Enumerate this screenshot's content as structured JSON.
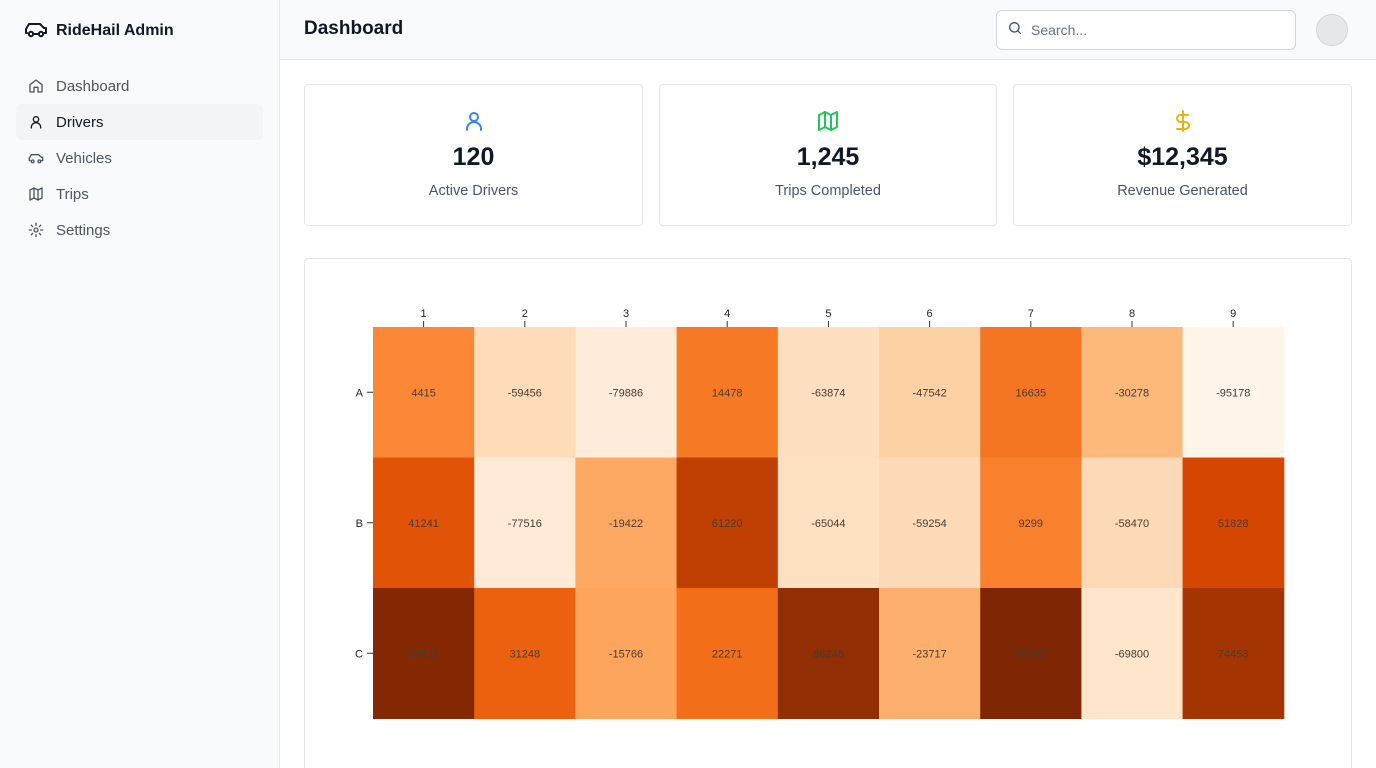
{
  "app": {
    "name": "RideHail Admin"
  },
  "sidebar": {
    "items": [
      {
        "label": "Dashboard",
        "icon": "home-icon",
        "active": false
      },
      {
        "label": "Drivers",
        "icon": "user-icon",
        "active": true
      },
      {
        "label": "Vehicles",
        "icon": "car-icon",
        "active": false
      },
      {
        "label": "Trips",
        "icon": "map-icon",
        "active": false
      },
      {
        "label": "Settings",
        "icon": "gear-icon",
        "active": false
      }
    ]
  },
  "header": {
    "title": "Dashboard",
    "search_placeholder": "Search..."
  },
  "stats": [
    {
      "value": "120",
      "label": "Active Drivers",
      "icon": "user-icon",
      "color": "#3b82f6"
    },
    {
      "value": "1,245",
      "label": "Trips Completed",
      "icon": "map-icon",
      "color": "#22c55e"
    },
    {
      "value": "$12,345",
      "label": "Revenue Generated",
      "icon": "dollar-icon",
      "color": "#eab308"
    }
  ],
  "chart_data": {
    "type": "heatmap",
    "title": "",
    "x_labels": [
      "1",
      "2",
      "3",
      "4",
      "5",
      "6",
      "7",
      "8",
      "9"
    ],
    "y_labels": [
      "A",
      "B",
      "C"
    ],
    "values": [
      [
        4415,
        -59456,
        -79886,
        14478,
        -63874,
        -47542,
        16635,
        -30278,
        -95178
      ],
      [
        41241,
        -77516,
        -19422,
        61220,
        -65044,
        -59254,
        9299,
        -58470,
        51828
      ],
      [
        94426,
        31248,
        -15766,
        22271,
        86246,
        -23717,
        97595,
        -69800,
        74453
      ]
    ],
    "color_scale": "oranges",
    "colors": {
      "low": "#fff5eb",
      "mid": "#fd8d3c",
      "high": "#7f2704"
    }
  }
}
